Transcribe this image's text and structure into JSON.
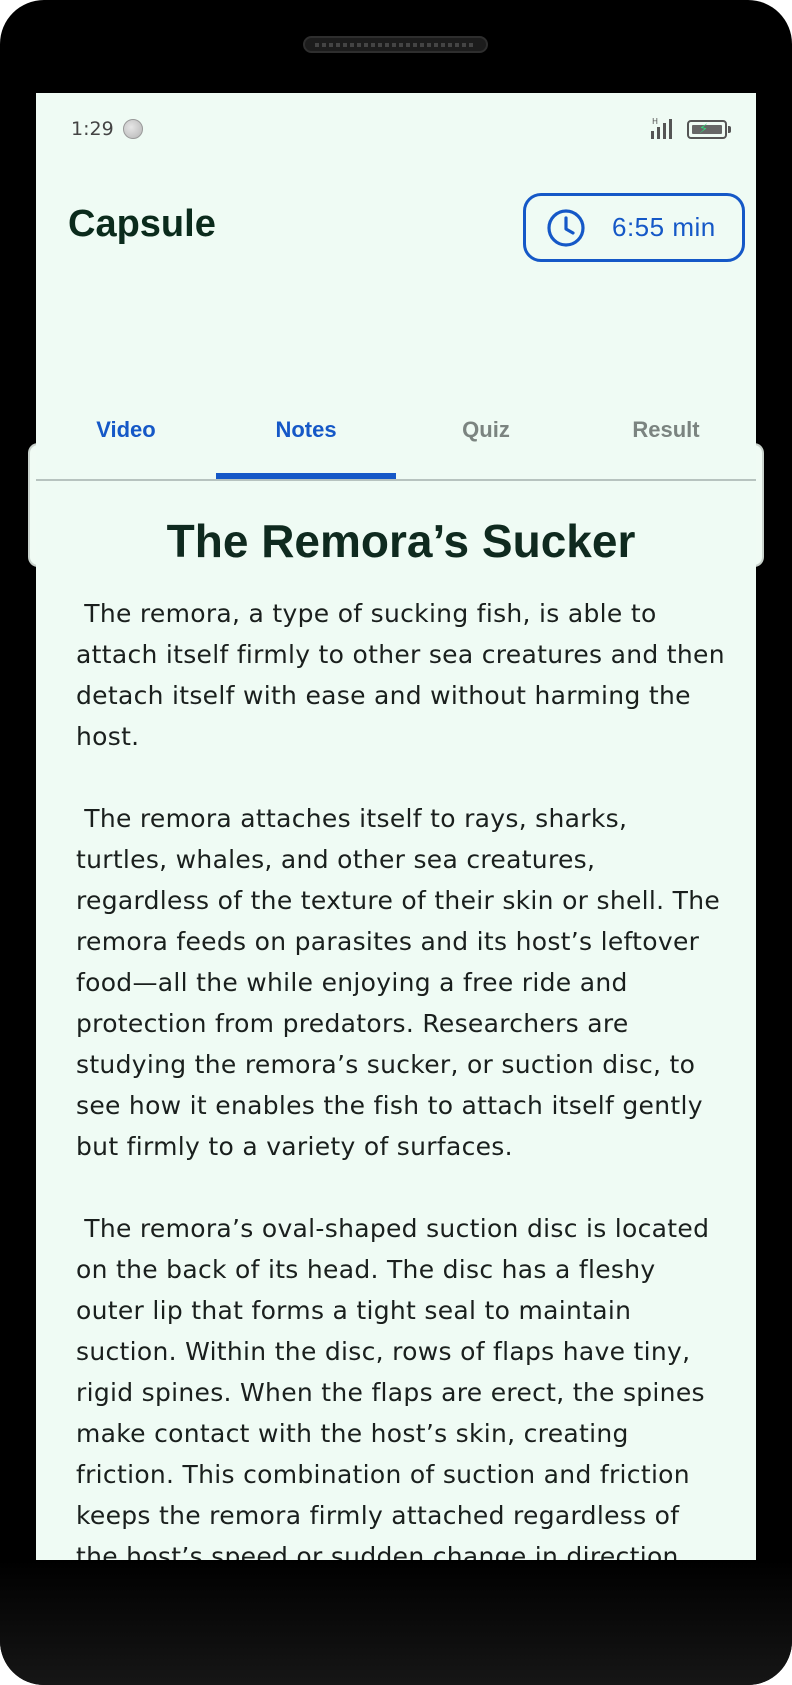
{
  "status_bar": {
    "time": "1:29"
  },
  "header": {
    "title": "Capsule",
    "timer_label": "6:55 min"
  },
  "tabs": [
    {
      "label": "Video",
      "active": false
    },
    {
      "label": "Notes",
      "active": true
    },
    {
      "label": "Quiz",
      "active": false
    },
    {
      "label": "Result",
      "active": false
    }
  ],
  "note": {
    "title": "The Remora’s Sucker",
    "paragraphs": [
      " The remora, a type of sucking fish, is able to attach itself firmly to other sea creatures and then detach itself with ease and without harming the host.",
      " The remora attaches itself to rays, sharks, turtles, whales, and other sea creatures, regardless of the texture of their skin or shell. The remora feeds on parasites and its host’s leftover food—all the while enjoying a free ride and protection from predators. Researchers are studying the remora’s sucker, or suction disc, to see how it enables the fish to attach itself gently but firmly to a variety of surfaces.",
      " The remora’s oval-shaped suction disc is located on the back of its head. The disc has a fleshy outer lip that forms a tight seal to maintain suction. Within the disc, rows of flaps have tiny, rigid spines. When the flaps are erect, the spines make contact with the host’s skin, creating friction. This combination of suction and friction keeps the remora firmly attached regardless of the host’s speed or sudden change in direction."
    ]
  },
  "colors": {
    "accent": "#1558c7",
    "background": "#effbf4",
    "inactive_tab": "#7b8480",
    "title_text": "#0b2b1c"
  },
  "icons": {
    "timer": "clock-icon",
    "status_indicator": "notification-dot-icon",
    "signal": "signal-icon",
    "battery": "battery-charging-icon"
  }
}
